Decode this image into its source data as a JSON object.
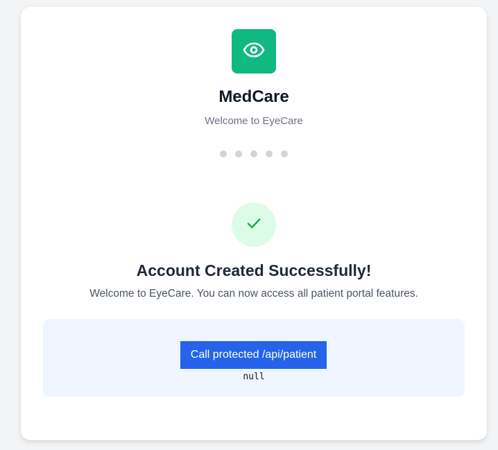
{
  "brand": {
    "name": "MedCare",
    "subtitle": "Welcome to EyeCare",
    "logo_icon": "eye-icon",
    "accent_color": "#10b981"
  },
  "progress": {
    "step_count": 5,
    "dot_color": "#d1d5db"
  },
  "success": {
    "icon": "check-icon",
    "title": "Account Created Successfully!",
    "message": "Welcome to EyeCare. You can now access all patient portal features."
  },
  "api": {
    "button_label": "Call protected /api/patient",
    "result": "null",
    "button_color": "#2563eb"
  }
}
